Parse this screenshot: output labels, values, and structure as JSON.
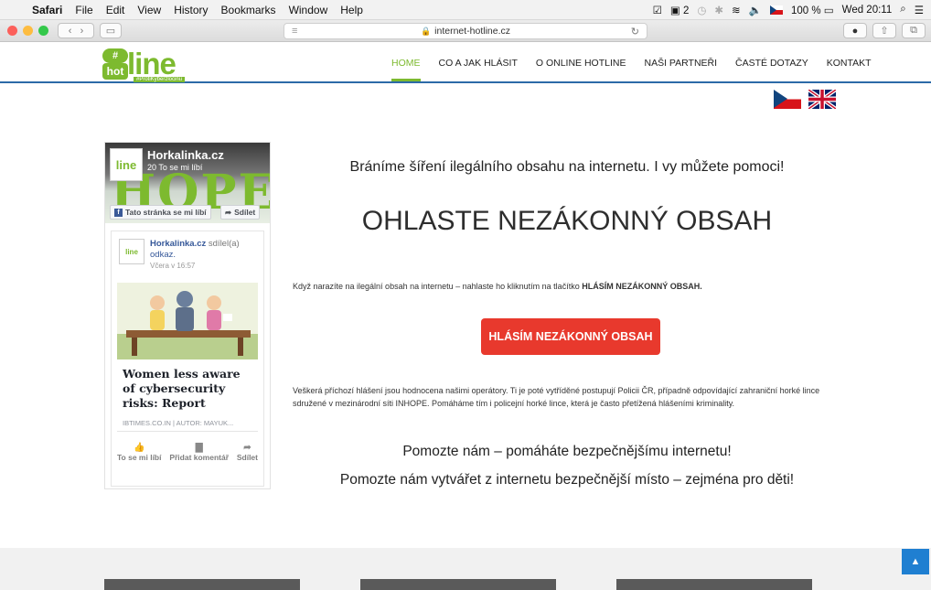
{
  "menubar": {
    "app": "Safari",
    "items": [
      "File",
      "Edit",
      "View",
      "History",
      "Bookmarks",
      "Window",
      "Help"
    ],
    "status": {
      "badge": "2",
      "battery": "100 %",
      "datetime": "Wed 20:11"
    }
  },
  "browser": {
    "url": "internet-hotline.cz"
  },
  "site": {
    "logo": {
      "hash": "#",
      "hot": "hot",
      "line": "line",
      "tagline": "#ProtiKyberzlocinu"
    },
    "nav": [
      "HOME",
      "CO A JAK HLÁSIT",
      "O ONLINE HOTLINE",
      "NAŠI PARTNEŘI",
      "ČASTÉ DOTAZY",
      "KONTAKT"
    ]
  },
  "facebook": {
    "page_name": "Horkalinka.cz",
    "likes": "20 To se mi líbí",
    "cover_text": "HOPE",
    "like_button": "Tato stránka se mi líbí",
    "share_button": "Sdílet",
    "post": {
      "author": "Horkalinka.cz",
      "author_suffix": "sdílel(a)",
      "link_word": "odkaz.",
      "time": "Včera v 16:57",
      "headline": "Women less aware of cybersecurity risks: Report",
      "source": "IBTIMES.CO.IN | AUTOR: MAYUK...",
      "actions": [
        {
          "icon": "thumbs-up",
          "label": "To se mi líbí"
        },
        {
          "icon": "comment",
          "label": "Přidat komentář"
        },
        {
          "icon": "share",
          "label": "Sdílet"
        }
      ]
    }
  },
  "main": {
    "subtitle": "Bráníme šíření ilegálního obsahu na internetu. I vy můžete pomoci!",
    "heading": "OHLASTE NEZÁKONNÝ OBSAH",
    "intro_text": "Když narazíte na ilegální obsah na internetu – nahlaste ho kliknutím na tlačítko ",
    "intro_bold": "HLÁSÍM NEZÁKONNÝ OBSAH.",
    "report_button": "HLÁSÍM NEZÁKONNÝ OBSAH",
    "description": "Veškerá příchozí hlášení jsou hodnocena našimi operátory. Ti je poté vytříděné postupují Policii ČR, případně odpovídající zahraniční horké lince sdružené v mezinárodní síti  INHOPE. Pomáháme tím i policejní horké lince, která je často přetížená hlášeními kriminality.",
    "help_line_1": "Pomozte nám – pomáháte bezpečnějšímu internetu!",
    "help_line_2": "Pomozte nám vytvářet z internetu bezpečnější místo – zejména pro děti!"
  },
  "colors": {
    "brand_green": "#7dba2f",
    "button_red": "#e8392d",
    "nav_rule": "#2c6aa8",
    "back_to_top": "#1f7fd1"
  }
}
